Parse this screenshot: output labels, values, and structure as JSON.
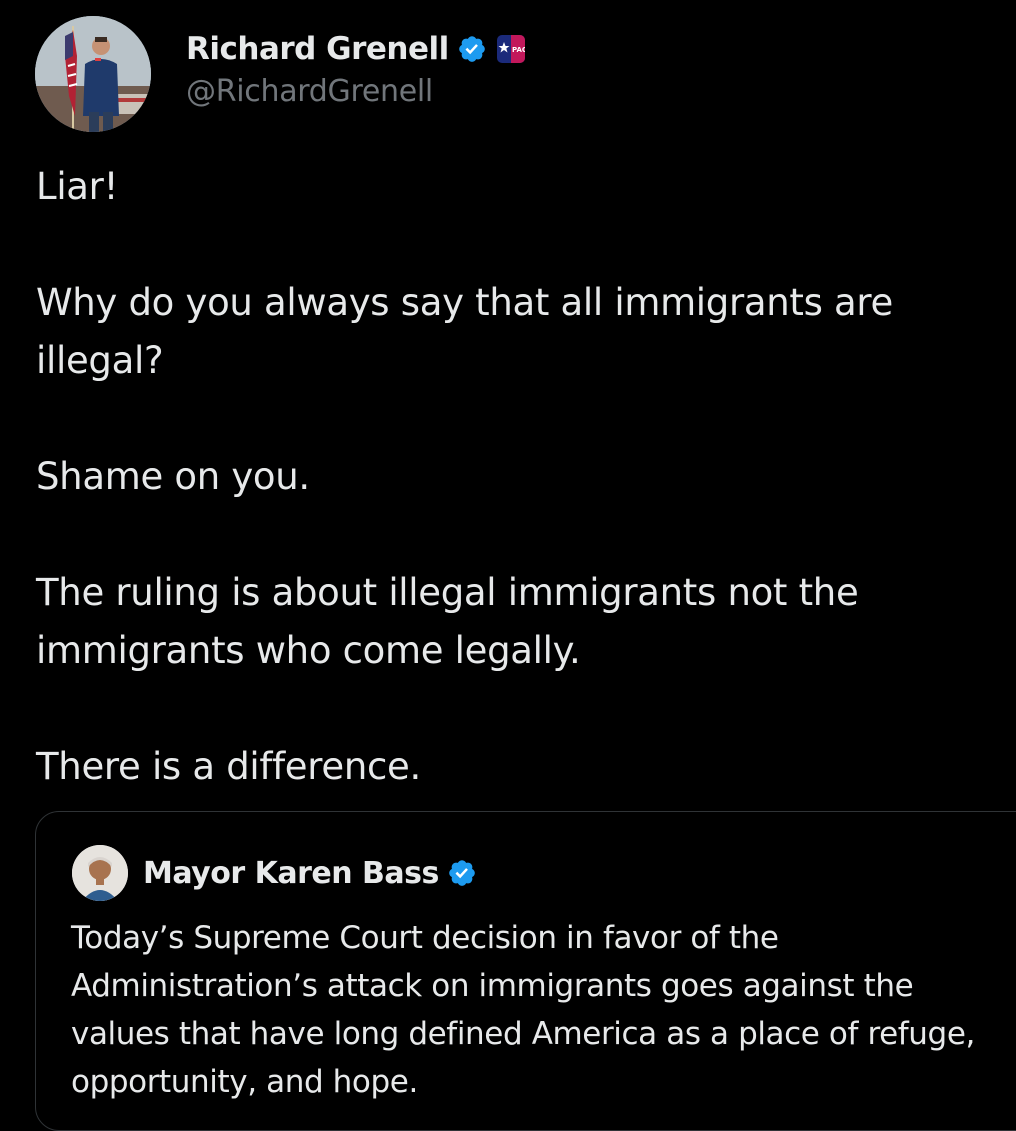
{
  "post": {
    "author": {
      "display_name": "Richard Grenell",
      "handle": "@RichardGrenell",
      "verified_icon": "verified-badge-icon",
      "affiliation_icon": "cpac-affiliation-badge"
    },
    "paragraphs": [
      "Liar!",
      "Why do you always say that all immigrants are illegal?",
      "Shame on you.",
      "The ruling is about illegal immigrants not the immigrants who come legally.",
      "There is a difference."
    ]
  },
  "quoted_post": {
    "author": {
      "display_name": "Mayor Karen Bass",
      "verified_icon": "verified-badge-icon"
    },
    "text": "Today’s Supreme Court decision in favor of the Administration’s attack on immigrants goes against the values that have long defined America as a place of refuge, opportunity, and hope."
  },
  "colors": {
    "background": "#000000",
    "text_primary": "#e7e9ea",
    "text_secondary": "#71767b",
    "verified_blue": "#1d9bf0",
    "border": "#2f3336"
  }
}
